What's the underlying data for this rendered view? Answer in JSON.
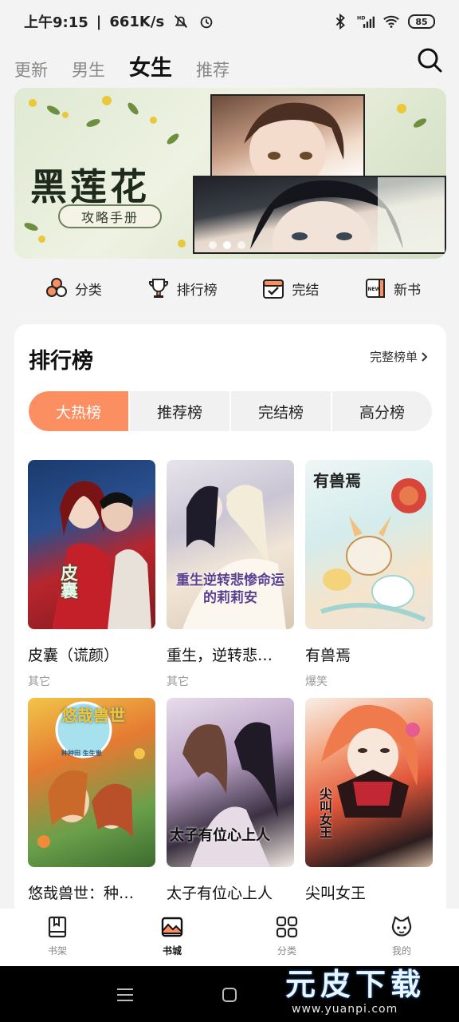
{
  "status_bar": {
    "time": "上午9:15",
    "speed": "661K/s",
    "battery": "85",
    "network": "HD"
  },
  "top_tabs": [
    {
      "label": "更新",
      "active": false
    },
    {
      "label": "男生",
      "active": false
    },
    {
      "label": "女生",
      "active": true
    },
    {
      "label": "推荐",
      "active": false
    }
  ],
  "banner": {
    "title": "黑莲花",
    "subtitle": "攻略手册",
    "dots": 3,
    "active_dot": 1
  },
  "quick_nav": [
    {
      "label": "分类",
      "icon": "category-icon"
    },
    {
      "label": "排行榜",
      "icon": "trophy-icon"
    },
    {
      "label": "完结",
      "icon": "calendar-check-icon"
    },
    {
      "label": "新书",
      "icon": "new-book-icon"
    }
  ],
  "ranking": {
    "title": "排行榜",
    "more": "完整榜单",
    "tabs": [
      "大热榜",
      "推荐榜",
      "完结榜",
      "高分榜"
    ],
    "active_tab": "大热榜",
    "books": [
      {
        "title": "皮囊（谎颜）",
        "tag": "其它",
        "cover_text": "皮囊"
      },
      {
        "title": "重生，逆转悲…",
        "tag": "其它",
        "cover_text": "重生逆转悲惨命运的莉莉安"
      },
      {
        "title": "有兽焉",
        "tag": "爆笑",
        "cover_text": "有兽焉"
      },
      {
        "title": "悠哉兽世：种…",
        "tag": "",
        "cover_text": "悠哉兽世",
        "cover_sub": "种种田 生生崽"
      },
      {
        "title": "太子有位心上人",
        "tag": "",
        "cover_text": "太子有位心上人"
      },
      {
        "title": "尖叫女王",
        "tag": "",
        "cover_text": "尖叫女王"
      }
    ]
  },
  "bottom_nav": [
    {
      "label": "书架",
      "icon": "bookshelf-icon",
      "active": false
    },
    {
      "label": "书城",
      "icon": "bookstore-icon",
      "active": true
    },
    {
      "label": "分类",
      "icon": "grid-icon",
      "active": false
    },
    {
      "label": "我的",
      "icon": "profile-icon",
      "active": false
    }
  ],
  "watermark": {
    "name": "元皮下载",
    "url": "www.yuanpi.com"
  },
  "colors": {
    "accent": "#fb8f61",
    "background": "#f3f3f3"
  }
}
